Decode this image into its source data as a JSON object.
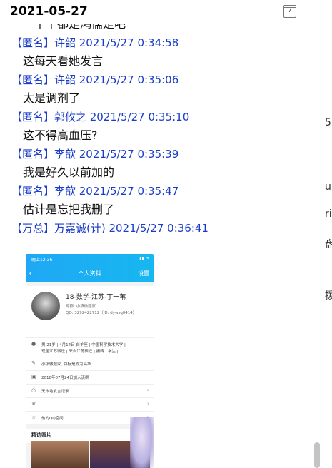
{
  "header": {
    "date": "2021-05-27",
    "calendar_day": "7"
  },
  "first_message_text": "一个个都是鸿儒是吧",
  "messages": [
    {
      "head": "【匿名】许韶 2021/5/27 0:34:58",
      "text": "这每天看她发言"
    },
    {
      "head": "【匿名】许韶 2021/5/27 0:35:06",
      "text": "太是调剂了"
    },
    {
      "head": "【匿名】郭攸之 2021/5/27 0:35:10",
      "text": "这不得高血压?"
    },
    {
      "head": "【匿名】李歆 2021/5/27 0:35:39",
      "text": "我是好久以前加的"
    },
    {
      "head": "【匿名】李歆 2021/5/27 0:35:47",
      "text": "估计是忘把我删了"
    },
    {
      "head": "【万总】万嘉诚(计) 2021/5/27 0:36:41",
      "text": ""
    }
  ],
  "image": {
    "status_time": "晚上12:36",
    "title": "个人资料",
    "settings": "设置",
    "nickname": "18-数学-江苏-丁一苇",
    "alias": "昵称: 小镇做题家",
    "qq": "QQ: 3292422712（ID: dywsq0414）",
    "info1": "男  21岁 | 4月14日 白羊座 | 中国科学技术大学 |",
    "info2": "现居江苏宿迁 | 来自江苏宿迁 | 搬砖 | 学生 | ...",
    "signature": "小镇做题家, 目标是成为高华",
    "joined": "2018年07月24日加入该群",
    "no_speech": "无本地发言记录",
    "qzone": "他的QQ空间",
    "photos": "精选照片"
  },
  "right_fragments": [
    "5",
    "ure",
    "riv",
    "盘",
    "援"
  ]
}
